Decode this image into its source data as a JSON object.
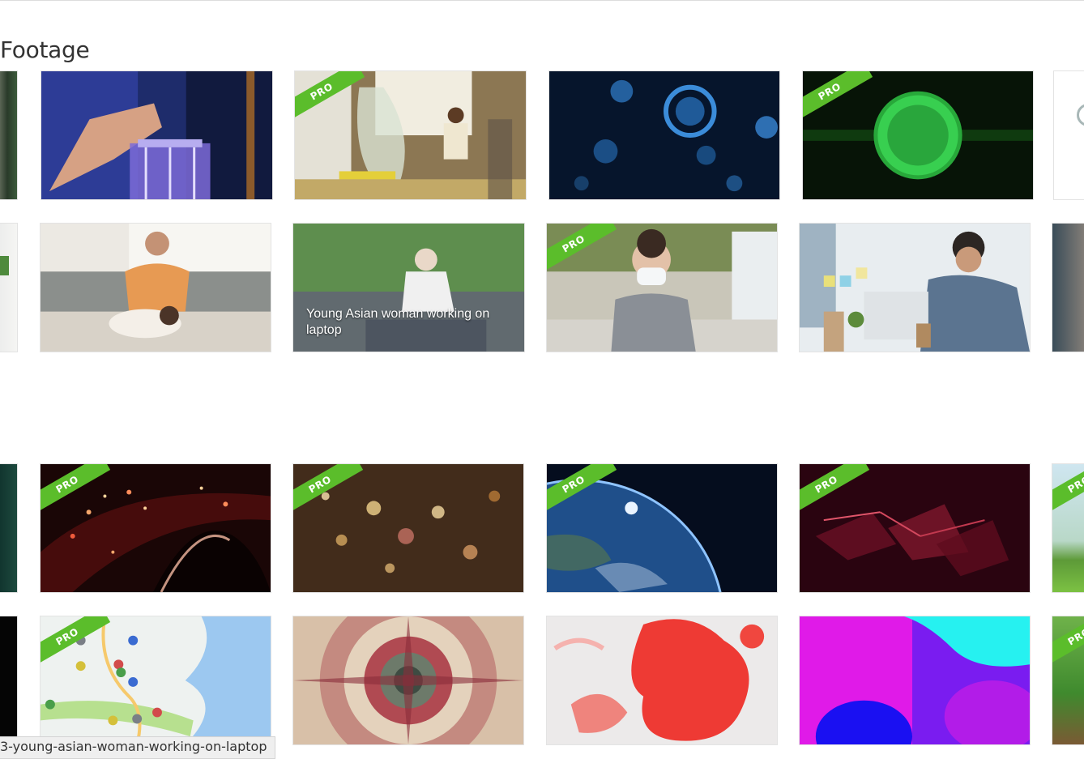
{
  "section": {
    "title": "Footage"
  },
  "badge": {
    "pro_label": "PRO"
  },
  "thumbnails": [
    {
      "id": "t-lab-left",
      "pro": false,
      "caption": ""
    },
    {
      "id": "t-lab-glass",
      "pro": false,
      "caption": ""
    },
    {
      "id": "t-lab-room",
      "pro": true,
      "caption": ""
    },
    {
      "id": "t-virus-blue",
      "pro": false,
      "caption": ""
    },
    {
      "id": "t-virus-green",
      "pro": true,
      "caption": ""
    },
    {
      "id": "t-white-right",
      "pro": false,
      "caption": ""
    },
    {
      "id": "t-plant-left",
      "pro": false,
      "caption": ""
    },
    {
      "id": "t-couple-couch",
      "pro": false,
      "caption": ""
    },
    {
      "id": "t-woman-laptop",
      "pro": false,
      "caption": "Young Asian woman working on laptop"
    },
    {
      "id": "t-mask-woman",
      "pro": true,
      "caption": ""
    },
    {
      "id": "t-man-office",
      "pro": false,
      "caption": ""
    },
    {
      "id": "t-right-partial-2",
      "pro": false,
      "caption": ""
    },
    {
      "id": "t-green-left",
      "pro": false,
      "caption": ""
    },
    {
      "id": "t-particles-red",
      "pro": true,
      "caption": ""
    },
    {
      "id": "t-bokeh-gold",
      "pro": true,
      "caption": ""
    },
    {
      "id": "t-earth",
      "pro": true,
      "caption": ""
    },
    {
      "id": "t-plexus-red",
      "pro": true,
      "caption": ""
    },
    {
      "id": "t-landscape-right",
      "pro": true,
      "caption": ""
    },
    {
      "id": "t-black-left",
      "pro": false,
      "caption": ""
    },
    {
      "id": "t-map-pins",
      "pro": true,
      "caption": ""
    },
    {
      "id": "t-kaleidoscope",
      "pro": false,
      "caption": ""
    },
    {
      "id": "t-red-ink",
      "pro": false,
      "caption": ""
    },
    {
      "id": "t-gradient-blobs",
      "pro": false,
      "caption": ""
    },
    {
      "id": "t-cartoon-right",
      "pro": true,
      "caption": ""
    }
  ],
  "statusbar": {
    "url": "3-young-asian-woman-working-on-laptop"
  },
  "colors": {
    "pro_badge": "#5bbd2b"
  }
}
